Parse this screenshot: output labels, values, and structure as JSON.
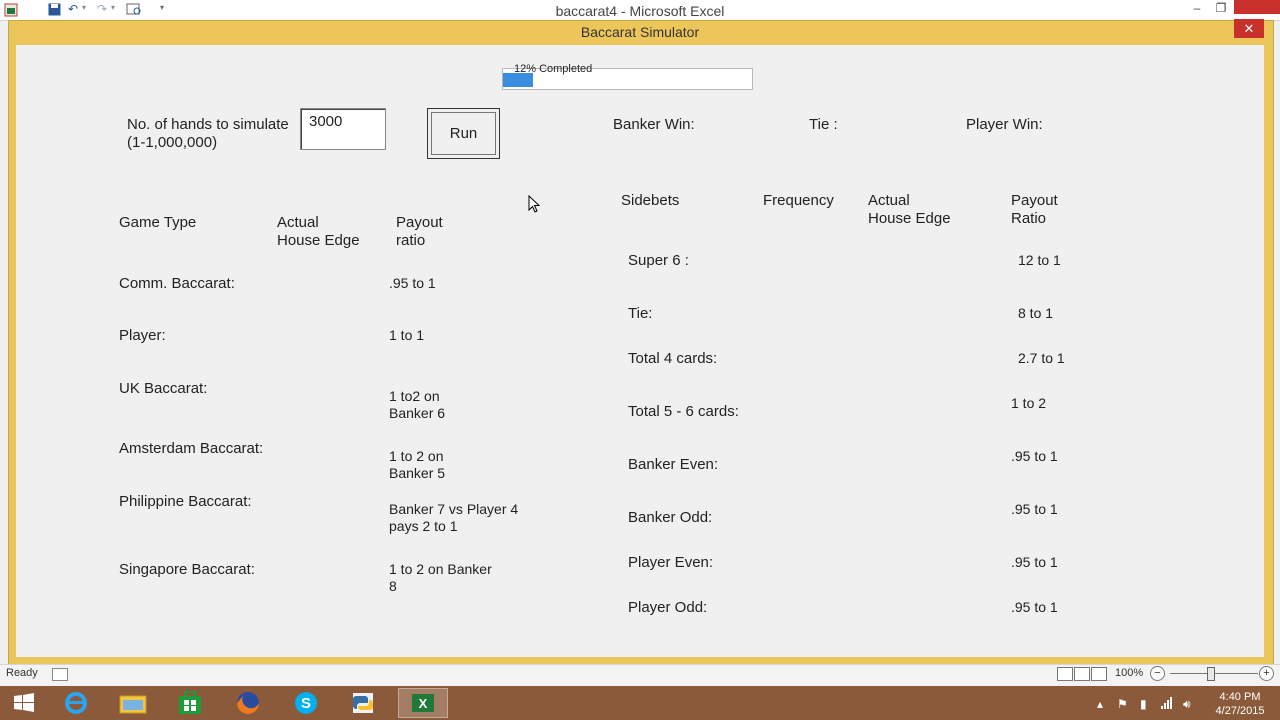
{
  "window": {
    "title": "baccarat4 - Microsoft Excel",
    "controls": {
      "minimize": "‒",
      "restore": "❐"
    }
  },
  "form": {
    "caption": "Baccarat Simulator",
    "close_label": "✕",
    "progress": {
      "text": "12% Completed",
      "fraction": 0.12
    },
    "hands_label": "No. of hands to simulate\n(1-1,000,000)",
    "hands_value": "3000",
    "run_label": "Run",
    "results": {
      "banker_win": "Banker Win:",
      "tie": "Tie :",
      "player_win": "Player Win:"
    },
    "game_table": {
      "headers": {
        "game_type": "Game Type",
        "house_edge": "Actual\nHouse Edge",
        "payout": "Payout\nratio"
      },
      "rows": [
        {
          "name": "Comm. Baccarat:",
          "payout": ".95 to 1"
        },
        {
          "name": "Player:",
          "payout": "1 to 1"
        },
        {
          "name": "UK Baccarat:",
          "payout": "1 to2 on\nBanker 6"
        },
        {
          "name": "Amsterdam Baccarat:",
          "payout": "1 to 2 on\nBanker 5"
        },
        {
          "name": "Philippine Baccarat:",
          "payout": "Banker 7 vs Player 4\npays 2 to 1"
        },
        {
          "name": "Singapore Baccarat:",
          "payout": "1 to 2 on Banker\n8"
        }
      ]
    },
    "sidebet_table": {
      "headers": {
        "sidebets": "Sidebets",
        "frequency": "Frequency",
        "house_edge": "Actual\nHouse Edge",
        "payout": "Payout\nRatio"
      },
      "rows": [
        {
          "name": "Super 6 :",
          "payout": "12 to 1"
        },
        {
          "name": "Tie:",
          "payout": "8 to 1"
        },
        {
          "name": "Total 4 cards:",
          "payout": "2.7 to 1"
        },
        {
          "name": "Total 5 - 6 cards:",
          "payout": "1 to 2"
        },
        {
          "name": "Banker Even:",
          "payout": ".95 to 1"
        },
        {
          "name": "Banker Odd:",
          "payout": ".95 to 1"
        },
        {
          "name": "Player Even:",
          "payout": ".95 to 1"
        },
        {
          "name": "Player Odd:",
          "payout": ".95 to 1"
        }
      ]
    }
  },
  "statusbar": {
    "ready": "Ready",
    "zoom": "100%",
    "zoom_minus": "−",
    "zoom_plus": "+"
  },
  "taskbar": {
    "time": "4:40 PM",
    "date": "4/27/2015"
  },
  "colors": {
    "form_frame": "#ecc65a",
    "close_red": "#c7302b",
    "progress_blue": "#3b8de0",
    "taskbar": "#8a5a3a"
  }
}
